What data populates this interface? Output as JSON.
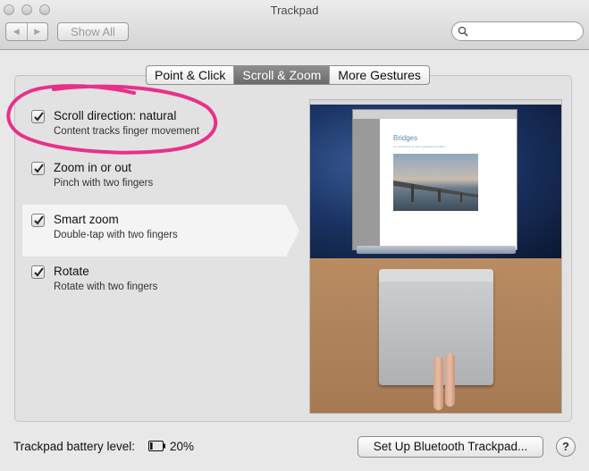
{
  "window": {
    "title": "Trackpad",
    "back_glyph": "◀",
    "forward_glyph": "▶",
    "show_all_label": "Show All",
    "search_placeholder": ""
  },
  "tabs": [
    {
      "label": "Point & Click",
      "active": false
    },
    {
      "label": "Scroll & Zoom",
      "active": true
    },
    {
      "label": "More Gestures",
      "active": false
    }
  ],
  "options": [
    {
      "title": "Scroll direction: natural",
      "subtitle": "Content tracks finger movement",
      "checked": true,
      "selected": false
    },
    {
      "title": "Zoom in or out",
      "subtitle": "Pinch with two fingers",
      "checked": true,
      "selected": false
    },
    {
      "title": "Smart zoom",
      "subtitle": "Double-tap with two fingers",
      "checked": true,
      "selected": true
    },
    {
      "title": "Rotate",
      "subtitle": "Rotate with two fingers",
      "checked": true,
      "selected": false
    }
  ],
  "preview": {
    "doc_title": "Bridges",
    "doc_subtitle": "An introduction to man's greatest innovation"
  },
  "footer": {
    "battery_label": "Trackpad battery level:",
    "battery_percent": "20%",
    "battery_level": 0.2,
    "setup_button": "Set Up Bluetooth Trackpad...",
    "help_label": "?"
  },
  "colors": {
    "annotation": "#e8308a",
    "selected_row": "#f4f4f4",
    "active_tab": "#7a7a7a"
  }
}
